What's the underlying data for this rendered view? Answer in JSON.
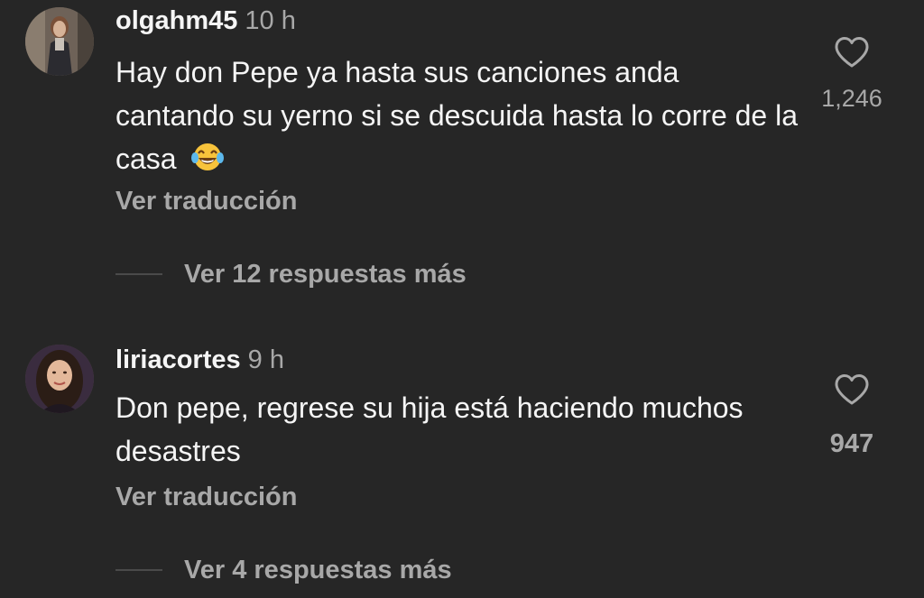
{
  "comments": [
    {
      "username": "olgahm45",
      "time": "10 h",
      "text": "Hay don Pepe ya hasta sus canciones anda cantando su yerno si se descuida hasta lo corre de la casa",
      "emoji": "face-with-tears-of-joy",
      "translate_label": "Ver traducción",
      "likes": "1,246",
      "replies_label": "Ver 12 respuestas más"
    },
    {
      "username": "liriacortes",
      "time": "9 h",
      "text": "Don pepe, regrese su hija está haciendo muchos desastres",
      "translate_label": "Ver traducción",
      "likes": "947",
      "replies_label": "Ver 4 respuestas más"
    }
  ],
  "colors": {
    "background": "#262626",
    "primary_text": "#f5f5f5",
    "secondary_text": "#a8a8a8"
  },
  "icons": {
    "like": "heart-outline-icon"
  }
}
